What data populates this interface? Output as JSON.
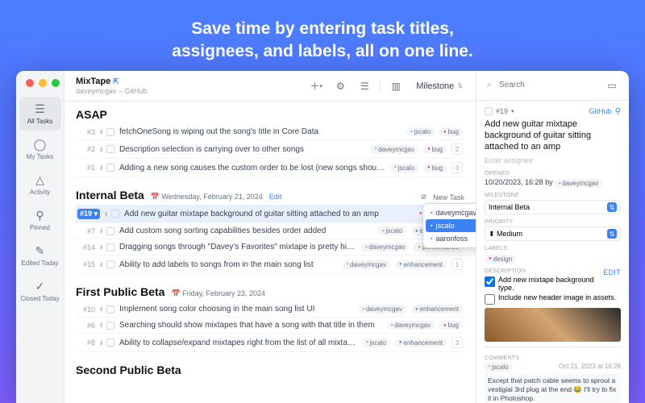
{
  "hero": {
    "l1": "Save time by entering task titles,",
    "l2": "assignees, and labels, all on one line."
  },
  "project": {
    "name": "MixTape",
    "sub": "daveymcgav – GitHub"
  },
  "toolbar": {
    "milestone": "Milestone",
    "search_ph": "Search"
  },
  "nav": [
    {
      "label": "All Tasks",
      "sel": true
    },
    {
      "label": "My Tasks"
    },
    {
      "label": "Activity"
    },
    {
      "label": "Pinned"
    },
    {
      "label": "Edited Today"
    },
    {
      "label": "Closed Today"
    }
  ],
  "sections": [
    {
      "title": "ASAP",
      "rows": [
        {
          "n": "#3",
          "p": "l",
          "t": "fetchOneSong is wiping out the song's title in Core Data",
          "u": "jscalo",
          "lab": "bug",
          "lc": "bug"
        },
        {
          "n": "#2",
          "p": "l",
          "t": "Description selection is carrying over to other songs",
          "u": "daveymcgav",
          "lab": "bug",
          "lc": "bug",
          "c": "2"
        },
        {
          "n": "#1",
          "p": "l",
          "t": "Adding a new song causes the custom order to be lost (new songs should be at the end of the added list)",
          "u": "jscalo",
          "lab": "bug",
          "lc": "bug",
          "c": "3"
        }
      ]
    },
    {
      "title": "Internal Beta",
      "date": "Wednesday, February 21, 2024",
      "edit": "Edit",
      "newtask": "New Task",
      "rows": [
        {
          "n": "#19",
          "p": "",
          "t": "Add new guitar mixtape background of guitar sitting attached to an amp",
          "lab": "design",
          "lc": "des",
          "sel": true,
          "c": "3"
        },
        {
          "n": "#7",
          "p": "l",
          "t": "Add custom song sorting capabilities besides order added",
          "u": "jscalo",
          "lab": "enhancement",
          "lc": "enh"
        },
        {
          "n": "#14",
          "p": "l",
          "t": "Dragging songs through \"Davey's Favorites\" mixtape is pretty hitchy when viewing",
          "u": "daveymcgav",
          "lab": "performance",
          "lc": "perf"
        },
        {
          "n": "#15",
          "p": "l",
          "t": "Ability to add labels to songs from in the main song list",
          "u": "daveymcgav",
          "lab": "enhancement",
          "lc": "enh",
          "c": "1"
        }
      ]
    },
    {
      "title": "First Public Beta",
      "date": "Friday, February 23, 2024",
      "rows": [
        {
          "n": "#10",
          "p": "l",
          "t": "Implement song color choosing in the main song list UI",
          "u": "daveymcgav",
          "lab": "enhancement",
          "lc": "enh"
        },
        {
          "n": "#6",
          "p": "l",
          "t": "Searching should show mixtapes that have a song with that title in them",
          "u": "daveymcgav",
          "lab": "bug",
          "lc": "bug"
        },
        {
          "n": "#8",
          "p": "l",
          "t": "Ability to collapse/expand mixtapes right from the list of all mixtapes (see Davey's designs)",
          "u": "jscalo",
          "lab": "enhancement",
          "lc": "enh",
          "c": "3"
        }
      ]
    },
    {
      "title": "Second Public Beta",
      "rows": []
    }
  ],
  "popup": [
    "daveymcgav",
    "jscalo",
    "aaronfoss"
  ],
  "detail": {
    "id": "#19",
    "gh": "GitHub",
    "title": "Add new guitar mixtape background of guitar sitting attached to an amp",
    "assign_ph": "Enter assignee",
    "opened": "10/20/2023, 16:28 by",
    "opened_u": "daveymcgav",
    "milestone": "Internal Beta",
    "priority": "Medium",
    "label": "design",
    "desc_edit": "Edit",
    "chk1": "Add new mixtape background type.",
    "chk2": "Include new header image in assets.",
    "comments_lbl": "COMMENTS",
    "comm_u": "jscalo",
    "comm_d": "Oct 21, 2023 at 16:28",
    "comm_t": "Except that patch cable seems to sprout a vestigial 3rd plug at the end 😂 I'll try to fix it in Photoshop."
  },
  "labels": {
    "opened": "OPENED",
    "milestone": "MILESTONE",
    "priority": "PRIORITY",
    "labels": "LABELS",
    "description": "DESCRIPTION"
  }
}
